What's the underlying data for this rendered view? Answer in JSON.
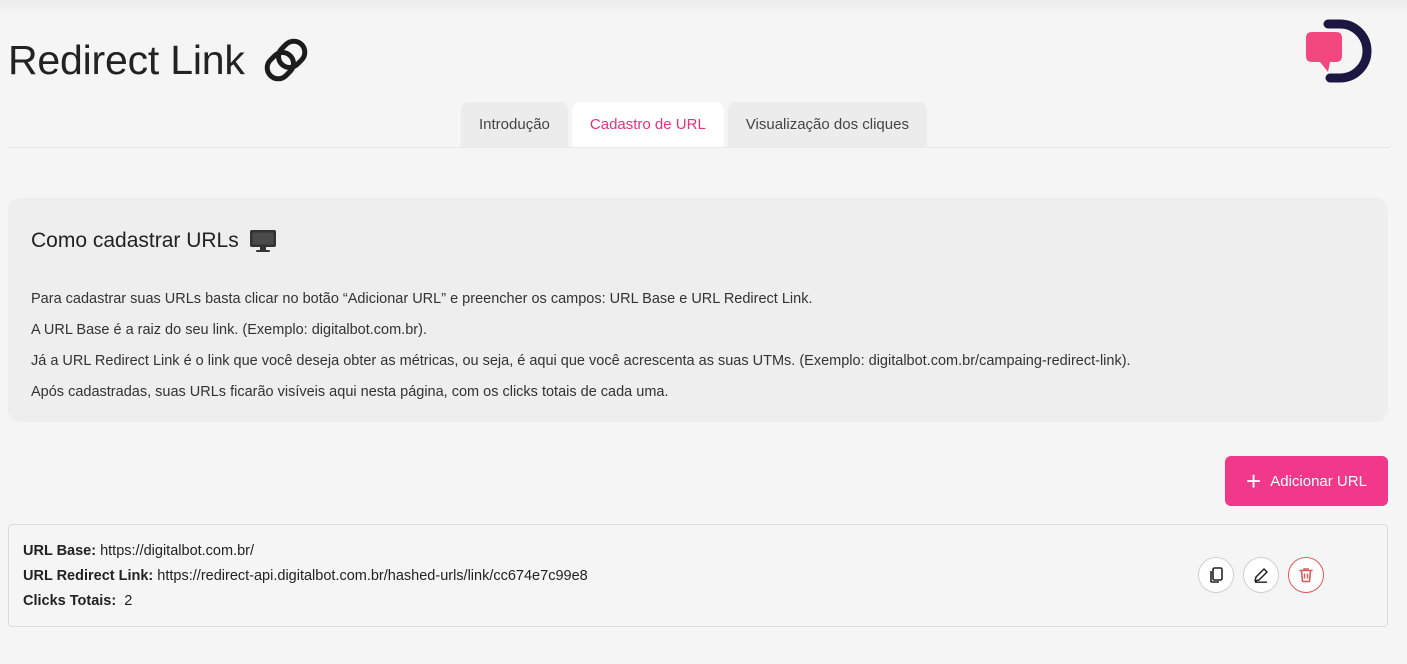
{
  "header": {
    "title": "Redirect Link"
  },
  "tabs": [
    {
      "label": "Introdução",
      "active": false
    },
    {
      "label": "Cadastro de URL",
      "active": true
    },
    {
      "label": "Visualização dos cliques",
      "active": false
    }
  ],
  "info": {
    "title": "Como cadastrar URLs",
    "lines": [
      "Para cadastrar suas URLs basta clicar no botão “Adicionar URL” e preencher os campos: URL Base e URL Redirect Link.",
      "A URL Base é a raiz do seu link. (Exemplo: digitalbot.com.br).",
      "Já a URL Redirect Link é o link que você deseja obter as métricas, ou seja, é aqui que você acrescenta as suas UTMs. (Exemplo: digitalbot.com.br/campaing-redirect-link).",
      "Após cadastradas, suas URLs ficarão visíveis aqui nesta página, com os clicks totais de cada uma."
    ]
  },
  "add_button": {
    "label": "Adicionar URL"
  },
  "url_entry": {
    "base_label": "URL Base:",
    "base_value": "https://digitalbot.com.br/",
    "redirect_label": "URL Redirect Link:",
    "redirect_value": "https://redirect-api.digitalbot.com.br/hashed-urls/link/cc674e7c99e8",
    "clicks_label": "Clicks Totais:",
    "clicks_value": "2"
  },
  "icons": {
    "title_icon": "link-icon",
    "info_icon": "monitor-icon",
    "add_icon": "plus-icon",
    "copy_icon": "copy-icon",
    "edit_icon": "pencil-icon",
    "delete_icon": "trash-icon"
  },
  "colors": {
    "accent": "#f1388a",
    "tab_active_text": "#e2337f",
    "logo_pink": "#f2487f",
    "logo_dark": "#1c1740",
    "danger": "#e05a5a"
  }
}
